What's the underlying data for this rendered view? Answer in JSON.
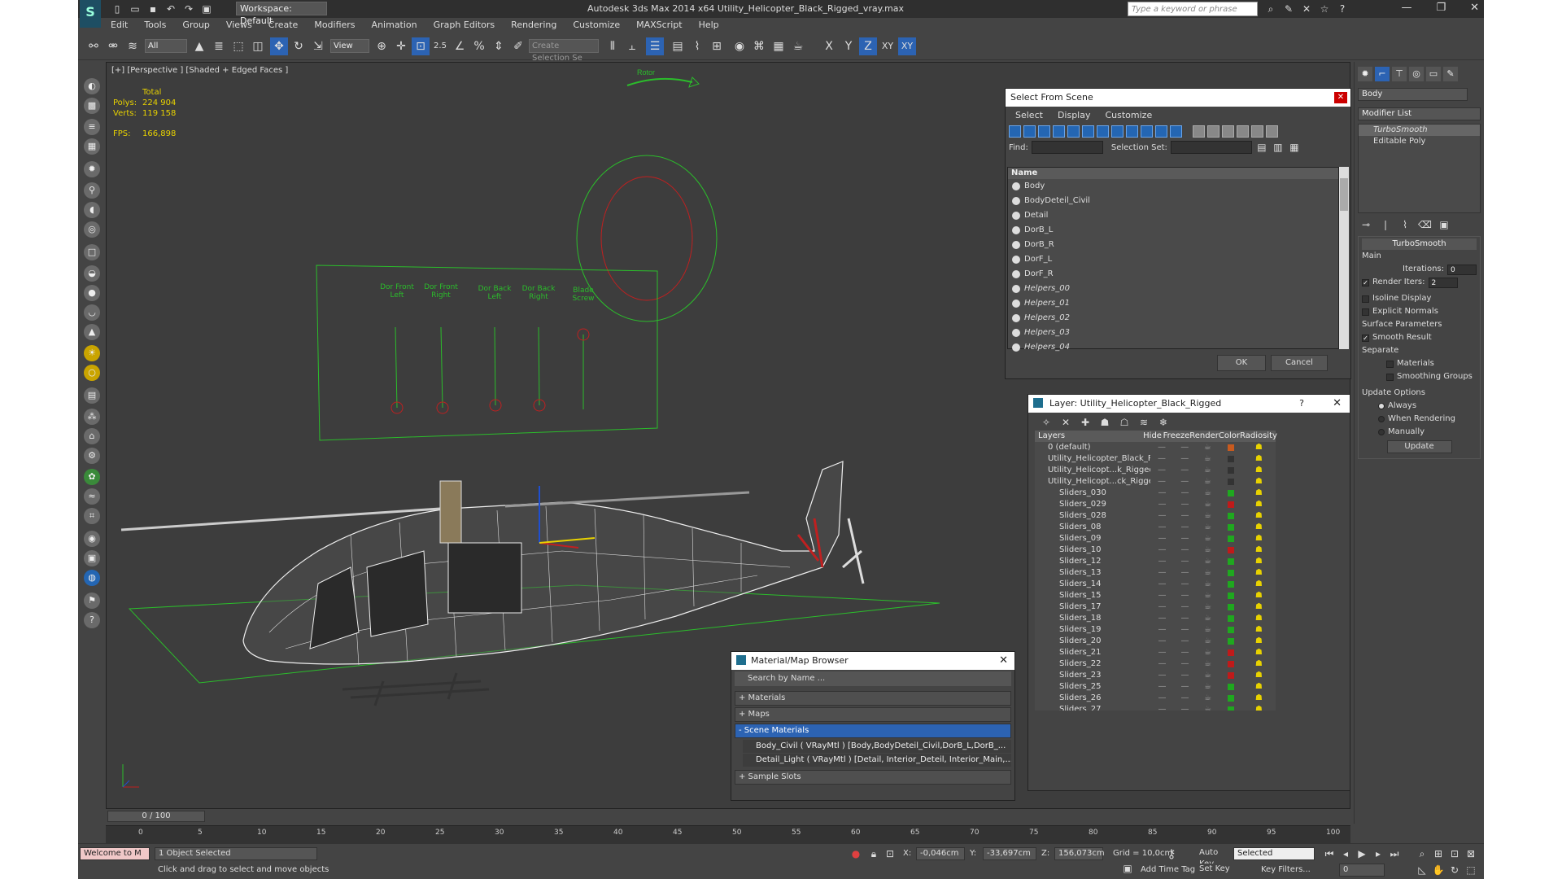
{
  "app": {
    "title": "Autodesk 3ds Max  2014 x64     Utility_Helicopter_Black_Rigged_vray.max",
    "workspace": "Workspace: Default",
    "search_placeholder": "Type a keyword or phrase",
    "menu": [
      "Edit",
      "Tools",
      "Group",
      "Views",
      "Create",
      "Modifiers",
      "Animation",
      "Graph Editors",
      "Rendering",
      "Customize",
      "MAXScript",
      "Help"
    ]
  },
  "toolbar": {
    "selection_filter": "All",
    "ref_coord": "View",
    "named_sel_placeholder": "Create Selection Se",
    "axis_x": "X",
    "axis_y": "Y",
    "axis_z": "Z",
    "axis_xy": "XY",
    "axis_xy2": "XY"
  },
  "viewport": {
    "label": "[+] [Perspective ] [Shaded + Edged Faces ]",
    "stats": {
      "total_label": "Total",
      "polys_label": "Polys:",
      "polys": "224 904",
      "verts_label": "Verts:",
      "verts": "119 158",
      "fps_label": "FPS:",
      "fps": "166,898"
    },
    "rotor_label": "Rotor",
    "sliders": [
      "Dor Front\nLeft",
      "Dor Front\nRight",
      "Dor Back\nLeft",
      "Dor Back\nRight",
      "Blade\nScrew"
    ]
  },
  "select_from_scene": {
    "title": "Select From Scene",
    "menu": [
      "Select",
      "Display",
      "Customize"
    ],
    "find_label": "Find:",
    "selection_set_label": "Selection Set:",
    "column": "Name",
    "items": [
      {
        "name": "Body",
        "italic": false
      },
      {
        "name": "BodyDeteil_Civil",
        "italic": false
      },
      {
        "name": "Detail",
        "italic": false
      },
      {
        "name": "DorB_L",
        "italic": false
      },
      {
        "name": "DorB_R",
        "italic": false
      },
      {
        "name": "DorF_L",
        "italic": false
      },
      {
        "name": "DorF_R",
        "italic": false
      },
      {
        "name": "Helpers_00",
        "italic": true
      },
      {
        "name": "Helpers_01",
        "italic": true
      },
      {
        "name": "Helpers_02",
        "italic": true
      },
      {
        "name": "Helpers_03",
        "italic": true
      },
      {
        "name": "Helpers_04",
        "italic": true
      }
    ],
    "ok": "OK",
    "cancel": "Cancel"
  },
  "layer_dialog": {
    "title": "Layer: Utility_Helicopter_Black_Rigged",
    "help": "?",
    "columns": [
      "Layers",
      "Hide",
      "Freeze",
      "Render",
      "Color",
      "Radiosity"
    ],
    "rows": [
      {
        "name": "0 (default)",
        "color": "#c85a1e"
      },
      {
        "name": "Utility_Helicopter_Black_Rigg",
        "color": "#333333"
      },
      {
        "name": "Utility_Helicopt...k_Rigged_H",
        "color": "#333333"
      },
      {
        "name": "Utility_Helicopt...ck_Rigged_",
        "color": "#333333"
      },
      {
        "name": "Sliders_030",
        "color": "#1fa81f"
      },
      {
        "name": "Sliders_029",
        "color": "#c01a1a"
      },
      {
        "name": "Sliders_028",
        "color": "#1fa81f"
      },
      {
        "name": "Sliders_08",
        "color": "#1fa81f"
      },
      {
        "name": "Sliders_09",
        "color": "#1fa81f"
      },
      {
        "name": "Sliders_10",
        "color": "#c01a1a"
      },
      {
        "name": "Sliders_12",
        "color": "#1fa81f"
      },
      {
        "name": "Sliders_13",
        "color": "#1fa81f"
      },
      {
        "name": "Sliders_14",
        "color": "#1fa81f"
      },
      {
        "name": "Sliders_15",
        "color": "#1fa81f"
      },
      {
        "name": "Sliders_17",
        "color": "#1fa81f"
      },
      {
        "name": "Sliders_18",
        "color": "#1fa81f"
      },
      {
        "name": "Sliders_19",
        "color": "#1fa81f"
      },
      {
        "name": "Sliders_20",
        "color": "#1fa81f"
      },
      {
        "name": "Sliders_21",
        "color": "#c01a1a"
      },
      {
        "name": "Sliders_22",
        "color": "#c01a1a"
      },
      {
        "name": "Sliders_23",
        "color": "#c01a1a"
      },
      {
        "name": "Sliders_25",
        "color": "#1fa81f"
      },
      {
        "name": "Sliders_26",
        "color": "#1fa81f"
      },
      {
        "name": "Sliders_27",
        "color": "#1fa81f"
      }
    ]
  },
  "material_browser": {
    "title": "Material/Map Browser",
    "search_placeholder": "Search by Name ...",
    "sections": [
      "+ Materials",
      "+ Maps",
      "- Scene Materials"
    ],
    "materials": [
      "Body_Civil  ( VRayMtl ) [Body,BodyDeteil_Civil,DorB_L,DorB_...",
      "Detail_Light  ( VRayMtl ) [Detail, Interior_Deteil, Interior_Main,..."
    ],
    "sample_slots": "+ Sample Slots"
  },
  "command_panel": {
    "object_name": "Body",
    "modifier_list": "Modifier List",
    "stack": [
      "TurboSmooth",
      "Editable Poly"
    ],
    "turbosmooth": {
      "title": "TurboSmooth",
      "main": "Main",
      "iterations_label": "Iterations:",
      "iterations": "0",
      "render_iters_label": "Render Iters:",
      "render_iters": "2",
      "isoline": "Isoline Display",
      "explicit_normals": "Explicit Normals",
      "surface_params": "Surface Parameters",
      "smooth_result": "Smooth Result",
      "separate": "Separate",
      "materials": "Materials",
      "smoothing_groups": "Smoothing Groups",
      "update_options": "Update Options",
      "always": "Always",
      "when_rendering": "When Rendering",
      "manually": "Manually",
      "update_btn": "Update"
    }
  },
  "timeline": {
    "frame": "0 / 100",
    "ticks": [
      "0",
      "5",
      "10",
      "15",
      "20",
      "25",
      "30",
      "35",
      "40",
      "45",
      "50",
      "55",
      "60",
      "65",
      "70",
      "75",
      "80",
      "85",
      "90",
      "95",
      "100"
    ]
  },
  "status": {
    "maxscript": "Welcome to M",
    "selected": "1 Object Selected",
    "prompt": "Click and drag to select and move objects",
    "x_label": "X:",
    "x": "-0,046cm",
    "y_label": "Y:",
    "y": "-33,697cm",
    "z_label": "Z:",
    "z": "156,073cm",
    "grid": "Grid = 10,0cm",
    "add_time_tag": "Add Time Tag",
    "auto_key": "Auto Key",
    "set_key": "Set Key",
    "selected_dropdown": "Selected",
    "key_filters": "Key Filters...",
    "frame_field": "0"
  }
}
